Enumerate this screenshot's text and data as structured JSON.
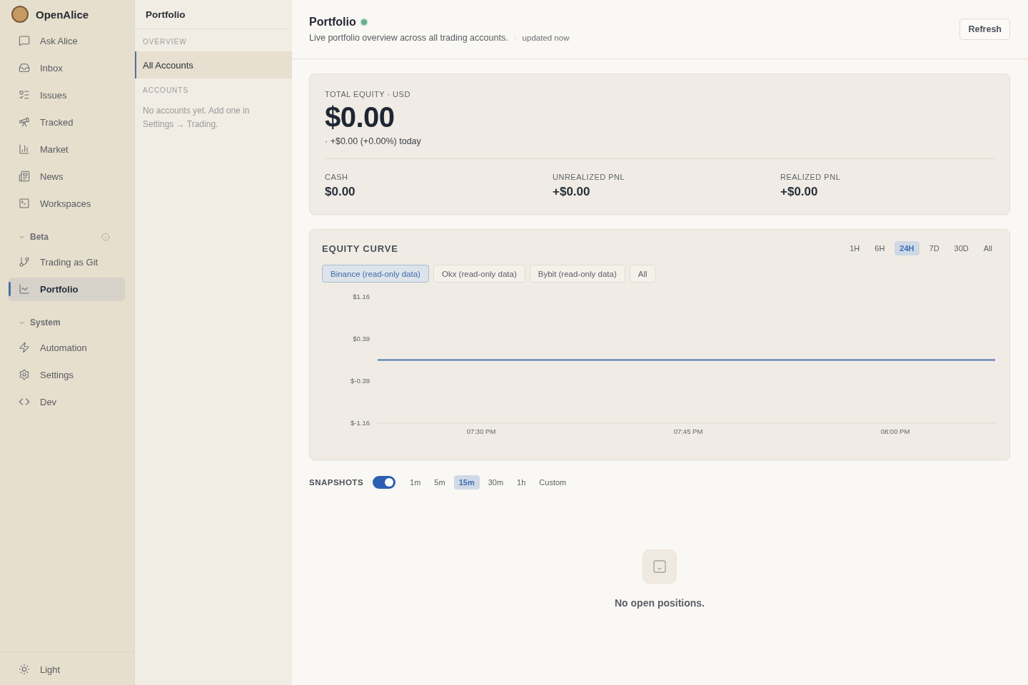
{
  "sidebar": {
    "brand": "OpenAlice",
    "items": [
      {
        "label": "Ask Alice",
        "selected": false
      },
      {
        "label": "Inbox",
        "selected": false
      },
      {
        "label": "Issues",
        "selected": false
      },
      {
        "label": "Tracked",
        "selected": false
      },
      {
        "label": "Market",
        "selected": false
      },
      {
        "label": "News",
        "selected": false
      },
      {
        "label": "Workspaces",
        "selected": false
      }
    ],
    "sections": [
      {
        "title": "Beta",
        "expanded": true,
        "has_info": true,
        "items": [
          {
            "label": "Trading as Git",
            "selected": false
          },
          {
            "label": "Portfolio",
            "selected": true
          }
        ]
      },
      {
        "title": "System",
        "expanded": true,
        "has_info": false,
        "items": [
          {
            "label": "Automation",
            "selected": false
          },
          {
            "label": "Settings",
            "selected": false
          },
          {
            "label": "Dev",
            "selected": false
          }
        ]
      }
    ],
    "theme_toggle": {
      "label": "Light"
    }
  },
  "subnav": {
    "title": "Portfolio",
    "groups": [
      {
        "heading": "OVERVIEW",
        "items": [
          {
            "label": "All Accounts",
            "selected": true
          }
        ]
      },
      {
        "heading": "ACCOUNTS",
        "empty_text": "No accounts yet. Add one in Settings → Trading."
      }
    ]
  },
  "header": {
    "title": "Portfolio",
    "live": true,
    "subtitle": "Live portfolio overview across all trading accounts.",
    "separator": "·",
    "updated": "updated now",
    "refresh_button": "Refresh"
  },
  "equity_summary": {
    "label": "TOTAL EQUITY · USD",
    "value": "$0.00",
    "change": "· +$0.00 (+0.00%) today",
    "stats": [
      {
        "label": "CASH",
        "value": "$0.00"
      },
      {
        "label": "UNREALIZED PNL",
        "value": "+$0.00"
      },
      {
        "label": "REALIZED PNL",
        "value": "+$0.00"
      }
    ]
  },
  "equity_curve": {
    "title": "EQUITY CURVE",
    "ranges": [
      {
        "label": "1H",
        "selected": false
      },
      {
        "label": "6H",
        "selected": false
      },
      {
        "label": "24H",
        "selected": true
      },
      {
        "label": "7D",
        "selected": false
      },
      {
        "label": "30D",
        "selected": false
      },
      {
        "label": "All",
        "selected": false
      }
    ],
    "accounts": [
      {
        "label": "Binance (read-only data)",
        "selected": true
      },
      {
        "label": "Okx (read-only data)",
        "selected": false
      },
      {
        "label": "Bybit (read-only data)",
        "selected": false
      },
      {
        "label": "All",
        "selected": false
      }
    ],
    "chart_data": {
      "type": "line",
      "categories": [
        null,
        "07:30 PM",
        null,
        "07:45 PM",
        null,
        "08:00 PM",
        null
      ],
      "values": [
        0,
        0,
        0,
        0,
        0,
        0,
        0
      ],
      "ylim": [
        -1.16,
        1.16
      ],
      "yticks": [
        {
          "value": 1.16,
          "label": "$1.16"
        },
        {
          "value": 0.39,
          "label": "$0.39"
        },
        {
          "value": -0.39,
          "label": "$-0.39"
        },
        {
          "value": -1.16,
          "label": "$-1.16"
        }
      ]
    }
  },
  "snapshots": {
    "label": "SNAPSHOTS",
    "on": true,
    "intervals": [
      {
        "label": "1m",
        "selected": false
      },
      {
        "label": "5m",
        "selected": false
      },
      {
        "label": "15m",
        "selected": true
      },
      {
        "label": "30m",
        "selected": false
      },
      {
        "label": "1h",
        "selected": false
      },
      {
        "label": "Custom",
        "selected": false
      }
    ]
  },
  "positions": {
    "empty_text": "No open positions."
  }
}
